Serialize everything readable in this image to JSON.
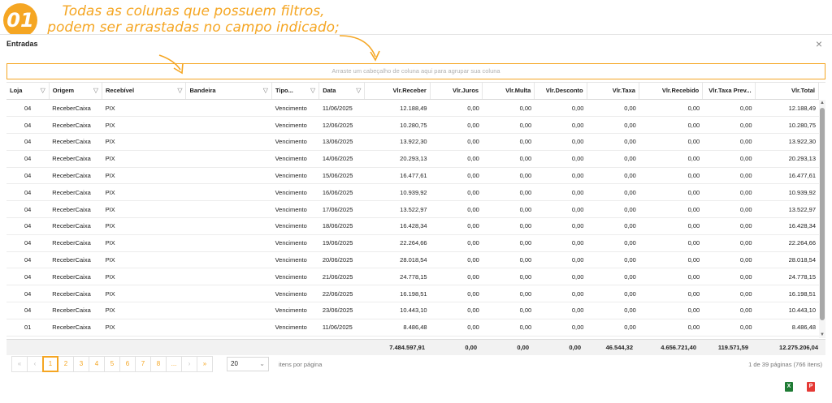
{
  "annotation": {
    "badge": "01",
    "line1": "Todas as colunas que possuem filtros,",
    "line2": "podem ser arrastadas no campo indicado;"
  },
  "window": {
    "title": "Entradas",
    "close": "×",
    "group_placeholder": "Arraste um cabeçalho de coluna aqui para agrupar sua coluna"
  },
  "grid": {
    "columns": [
      "Loja",
      "Origem",
      "Recebível",
      "Bandeira",
      "Tipo...",
      "Data",
      "Vlr.Receber",
      "Vlr.Juros",
      "Vlr.Multa",
      "Vlr.Desconto",
      "Vlr.Taxa",
      "Vlr.Recebido",
      "Vlr.Taxa Prev...",
      "Vlr.Total"
    ],
    "filterable": [
      "Loja",
      "Origem",
      "Recebível",
      "Bandeira",
      "Tipo...",
      "Data"
    ],
    "rows": [
      [
        "04",
        "ReceberCaixa",
        "PIX",
        "",
        "Vencimento",
        "11/06/2025",
        "12.188,49",
        "0,00",
        "0,00",
        "0,00",
        "0,00",
        "0,00",
        "0,00",
        "12.188,49"
      ],
      [
        "04",
        "ReceberCaixa",
        "PIX",
        "",
        "Vencimento",
        "12/06/2025",
        "10.280,75",
        "0,00",
        "0,00",
        "0,00",
        "0,00",
        "0,00",
        "0,00",
        "10.280,75"
      ],
      [
        "04",
        "ReceberCaixa",
        "PIX",
        "",
        "Vencimento",
        "13/06/2025",
        "13.922,30",
        "0,00",
        "0,00",
        "0,00",
        "0,00",
        "0,00",
        "0,00",
        "13.922,30"
      ],
      [
        "04",
        "ReceberCaixa",
        "PIX",
        "",
        "Vencimento",
        "14/06/2025",
        "20.293,13",
        "0,00",
        "0,00",
        "0,00",
        "0,00",
        "0,00",
        "0,00",
        "20.293,13"
      ],
      [
        "04",
        "ReceberCaixa",
        "PIX",
        "",
        "Vencimento",
        "15/06/2025",
        "16.477,61",
        "0,00",
        "0,00",
        "0,00",
        "0,00",
        "0,00",
        "0,00",
        "16.477,61"
      ],
      [
        "04",
        "ReceberCaixa",
        "PIX",
        "",
        "Vencimento",
        "16/06/2025",
        "10.939,92",
        "0,00",
        "0,00",
        "0,00",
        "0,00",
        "0,00",
        "0,00",
        "10.939,92"
      ],
      [
        "04",
        "ReceberCaixa",
        "PIX",
        "",
        "Vencimento",
        "17/06/2025",
        "13.522,97",
        "0,00",
        "0,00",
        "0,00",
        "0,00",
        "0,00",
        "0,00",
        "13.522,97"
      ],
      [
        "04",
        "ReceberCaixa",
        "PIX",
        "",
        "Vencimento",
        "18/06/2025",
        "16.428,34",
        "0,00",
        "0,00",
        "0,00",
        "0,00",
        "0,00",
        "0,00",
        "16.428,34"
      ],
      [
        "04",
        "ReceberCaixa",
        "PIX",
        "",
        "Vencimento",
        "19/06/2025",
        "22.264,66",
        "0,00",
        "0,00",
        "0,00",
        "0,00",
        "0,00",
        "0,00",
        "22.264,66"
      ],
      [
        "04",
        "ReceberCaixa",
        "PIX",
        "",
        "Vencimento",
        "20/06/2025",
        "28.018,54",
        "0,00",
        "0,00",
        "0,00",
        "0,00",
        "0,00",
        "0,00",
        "28.018,54"
      ],
      [
        "04",
        "ReceberCaixa",
        "PIX",
        "",
        "Vencimento",
        "21/06/2025",
        "24.778,15",
        "0,00",
        "0,00",
        "0,00",
        "0,00",
        "0,00",
        "0,00",
        "24.778,15"
      ],
      [
        "04",
        "ReceberCaixa",
        "PIX",
        "",
        "Vencimento",
        "22/06/2025",
        "16.198,51",
        "0,00",
        "0,00",
        "0,00",
        "0,00",
        "0,00",
        "0,00",
        "16.198,51"
      ],
      [
        "04",
        "ReceberCaixa",
        "PIX",
        "",
        "Vencimento",
        "23/06/2025",
        "10.443,10",
        "0,00",
        "0,00",
        "0,00",
        "0,00",
        "0,00",
        "0,00",
        "10.443,10"
      ],
      [
        "01",
        "ReceberCaixa",
        "PIX",
        "",
        "Vencimento",
        "11/06/2025",
        "8.486,48",
        "0,00",
        "0,00",
        "0,00",
        "0,00",
        "0,00",
        "0,00",
        "8.486,48"
      ]
    ],
    "totals": [
      "",
      "",
      "",
      "",
      "",
      "",
      "7.484.597,91",
      "0,00",
      "0,00",
      "0,00",
      "46.544,32",
      "4.656.721,40",
      "119.571,59",
      "12.275.206,04"
    ]
  },
  "pager": {
    "first": "«",
    "prev": "‹",
    "pages": [
      "1",
      "2",
      "3",
      "4",
      "5",
      "6",
      "7",
      "8",
      "..."
    ],
    "active_page": "1",
    "next": "›",
    "last": "»",
    "page_size": "20",
    "per_page_label": "itens por página",
    "info": "1 de 39 páginas (766 itens)"
  },
  "export": {
    "excel_label": "X",
    "pdf_label": "P"
  },
  "colors": {
    "accent": "#f5a623",
    "excel": "#1e7b34",
    "pdf": "#e53935"
  }
}
